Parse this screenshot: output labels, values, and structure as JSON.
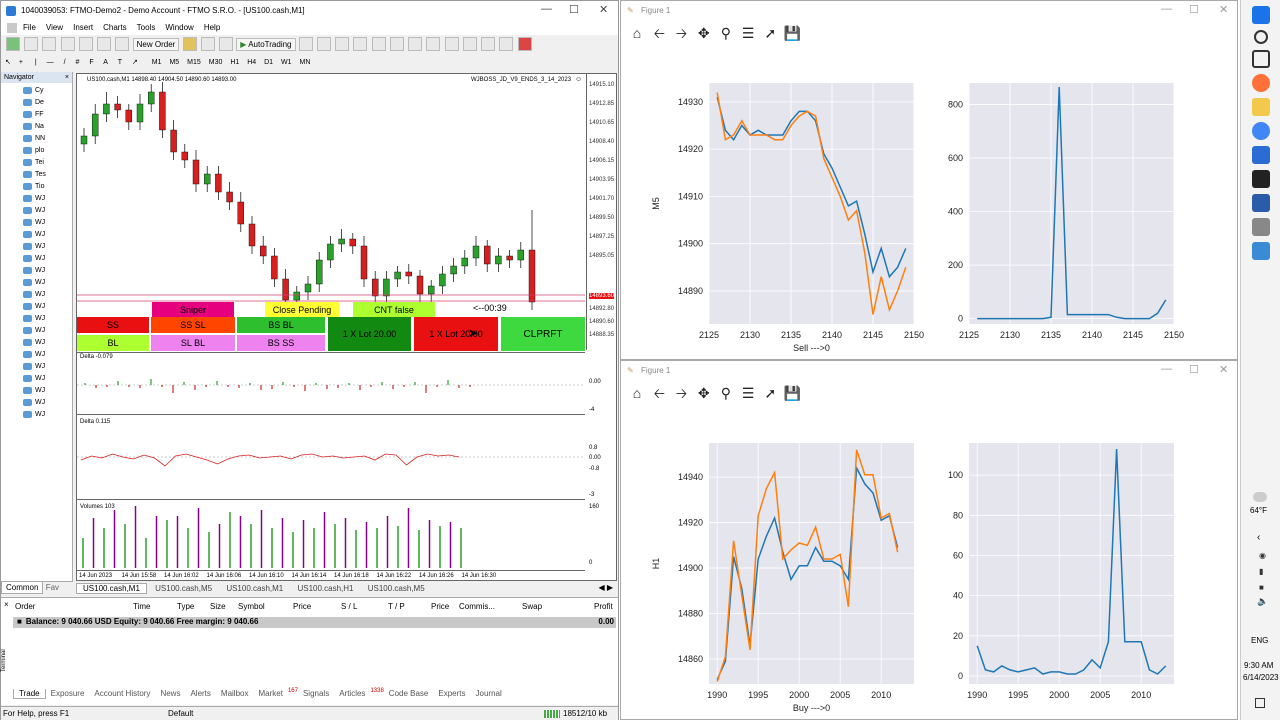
{
  "mt": {
    "title": "1040039053: FTMO-Demo2 - Demo Account - FTMO S.R.O. - [US100.cash,M1]",
    "menu": [
      "File",
      "View",
      "Insert",
      "Charts",
      "Tools",
      "Window",
      "Help"
    ],
    "new_order": "New Order",
    "autotrading": "AutoTrading",
    "timeframes": [
      "M1",
      "M5",
      "M15",
      "M30",
      "H1",
      "H4",
      "D1",
      "W1",
      "MN"
    ],
    "navigator_title": "Navigator",
    "nav_items": [
      "Cy",
      "De",
      "FF",
      "Na",
      "NN",
      "plo",
      "Tei",
      "Tes",
      "Tio",
      "WJ",
      "WJ",
      "WJ",
      "WJ",
      "WJ",
      "WJ",
      "WJ",
      "WJ",
      "WJ",
      "WJ",
      "WJ",
      "WJ",
      "WJ",
      "WJ",
      "WJ",
      "WJ",
      "WJ",
      "WJ",
      "WJ"
    ],
    "nav_tabs": [
      "Common",
      "Fav"
    ],
    "chart_header": "US100.cash,M1  14898.40 14904.50 14890.60 14893.00",
    "ea_label": "WJBOSS_JD_V9_ENDS_3_14_2023",
    "price_labels": [
      "14915.10",
      "14912.85",
      "14910.65",
      "14908.40",
      "14906.15",
      "14903.95",
      "14901.70",
      "14899.50",
      "14897.25",
      "14895.05",
      "14893.60",
      "14892.80",
      "14890.60",
      "14888.35"
    ],
    "current_price": "14893.60",
    "timer": "<--00:39",
    "btn_sniper": "Sniper",
    "btn_close_pending": "Close Pending",
    "btn_cnt": "CNT  false",
    "btn_ss": "SS",
    "btn_ss_sl": "SS SL",
    "btn_bs_bl": "BS BL",
    "btn_lot20": "1 X Lot 20.00",
    "btn_lot": "1 X Lot 20.00",
    "btn_clprft": "CLPRFT",
    "btn_bl": "BL",
    "btn_sl_bl": "SL BL",
    "btn_bs_ss": "BS SS",
    "delta1_label": "Delta -0.079",
    "delta1_scale": [
      "0.00",
      "-4"
    ],
    "delta2_label": "Delta 0.115",
    "delta2_scale": [
      "0.8",
      "0.00",
      "-0.8",
      "-3"
    ],
    "vol_label": "Volumes 103",
    "vol_scale": [
      "160",
      "0"
    ],
    "time_labels": [
      "14 Jun 2023",
      "14 Jun 15:58",
      "14 Jun 16:02",
      "14 Jun 16:06",
      "14 Jun 16:10",
      "14 Jun 16:14",
      "14 Jun 16:18",
      "14 Jun 16:22",
      "14 Jun 16:26",
      "14 Jun 16:30"
    ],
    "chart_tabs": [
      "US100.cash,M1",
      "US100.cash,M5",
      "US100.cash,M1",
      "US100.cash,H1",
      "US100.cash,M5"
    ],
    "term_cols": [
      "Order",
      "Time",
      "Type",
      "Size",
      "Symbol",
      "Price",
      "S / L",
      "T / P",
      "Price",
      "Commis...",
      "Swap",
      "Profit"
    ],
    "balance": "Balance: 9 040.66 USD  Equity: 9 040.66  Free margin: 9 040.66",
    "profit": "0.00",
    "term_tabs": [
      "Trade",
      "Exposure",
      "Account History",
      "News",
      "Alerts",
      "Mailbox",
      "Market",
      "Signals",
      "Articles",
      "Code Base",
      "Experts",
      "Journal"
    ],
    "market_badge": "167",
    "articles_badge": "1338",
    "terminal_side": "Terminal",
    "status_left": "For Help, press F1",
    "status_mid": "Default",
    "status_right": "18512/10 kb"
  },
  "fig1": {
    "title": "Figure 1",
    "left": {
      "ylabel": "M5",
      "xlabel": "Sell --->0",
      "xticks": [
        "2125",
        "2130",
        "2135",
        "2140",
        "2145",
        "2150"
      ],
      "yticks": [
        "14930",
        "14920",
        "14910",
        "14900",
        "14890"
      ]
    },
    "right": {
      "xticks": [
        "2125",
        "2130",
        "2135",
        "2140",
        "2145",
        "2150"
      ],
      "yticks": [
        "800",
        "600",
        "400",
        "200",
        "0"
      ]
    }
  },
  "fig2": {
    "title": "Figure 1",
    "left": {
      "ylabel": "H1",
      "xlabel": "Buy --->0",
      "xticks": [
        "1990",
        "1995",
        "2000",
        "2005",
        "2010"
      ],
      "yticks": [
        "14940",
        "14920",
        "14900",
        "14880",
        "14860"
      ]
    },
    "right": {
      "xticks": [
        "1990",
        "1995",
        "2000",
        "2005",
        "2010"
      ],
      "yticks": [
        "100",
        "80",
        "60",
        "40",
        "20",
        "0"
      ]
    }
  },
  "taskbar": {
    "weather": "64°F",
    "lang": "ENG",
    "time": "9:30 AM",
    "date": "6/14/2023"
  },
  "colors": {
    "blue": "#1f77b4",
    "orange": "#ff7f0e",
    "plotbg": "#e5e5ee"
  },
  "chart_data": [
    {
      "type": "line",
      "ylabel": "M5",
      "xlabel": "Sell --->0",
      "xlim": [
        2125,
        2150
      ],
      "ylim": [
        14883,
        14934
      ],
      "x": [
        2126,
        2127,
        2128,
        2129,
        2130,
        2131,
        2132,
        2133,
        2134,
        2135,
        2136,
        2137,
        2138,
        2139,
        2140,
        2141,
        2142,
        2143,
        2144,
        2145,
        2146,
        2147,
        2148,
        2149
      ],
      "series": [
        {
          "values": [
            14931,
            14924,
            14922,
            14925,
            14923,
            14924,
            14923,
            14923,
            14923,
            14926,
            14928,
            14928,
            14926,
            14919,
            14916,
            14912,
            14908,
            14909,
            14902,
            14894,
            14899,
            14893,
            14895,
            14899
          ]
        },
        {
          "values": [
            14932,
            14922,
            14923,
            14926,
            14923,
            14923,
            14923,
            14922,
            14922,
            14925,
            14927,
            14928,
            14927,
            14918,
            14914,
            14910,
            14905,
            14907,
            14898,
            14885,
            14893,
            14886,
            14890,
            14895
          ]
        }
      ]
    },
    {
      "type": "line",
      "xlim": [
        2125,
        2150
      ],
      "ylim": [
        -20,
        880
      ],
      "x": [
        2126,
        2127,
        2128,
        2129,
        2130,
        2131,
        2132,
        2133,
        2134,
        2135,
        2136,
        2137,
        2138,
        2139,
        2140,
        2141,
        2142,
        2143,
        2144,
        2145,
        2146,
        2147,
        2148,
        2149
      ],
      "series": [
        {
          "values": [
            0,
            0,
            0,
            0,
            0,
            0,
            0,
            0,
            0,
            5,
            865,
            15,
            15,
            15,
            15,
            15,
            15,
            5,
            0,
            0,
            0,
            0,
            20,
            70
          ]
        }
      ]
    },
    {
      "type": "line",
      "ylabel": "H1",
      "xlabel": "Buy --->0",
      "xlim": [
        1989,
        2014
      ],
      "ylim": [
        14849,
        14955
      ],
      "x": [
        1990,
        1991,
        1992,
        1993,
        1994,
        1995,
        1996,
        1997,
        1998,
        1999,
        2000,
        2001,
        2002,
        2003,
        2004,
        2005,
        2006,
        2007,
        2008,
        2009,
        2010,
        2011,
        2012,
        2013
      ],
      "series": [
        {
          "values": [
            14851,
            14859,
            14905,
            14891,
            14866,
            14904,
            14914,
            14922,
            14907,
            14895,
            14901,
            14901,
            14909,
            14903,
            14903,
            14901,
            14895,
            14944,
            14937,
            14933,
            14921,
            14923,
            14909
          ]
        },
        {
          "values": [
            14850,
            14861,
            14912,
            14888,
            14864,
            14923,
            14935,
            14942,
            14904,
            14908,
            14911,
            14910,
            14918,
            14904,
            14904,
            14906,
            14883,
            14952,
            14941,
            14941,
            14922,
            14924,
            14907
          ]
        }
      ]
    },
    {
      "type": "line",
      "xlim": [
        1989,
        2014
      ],
      "ylim": [
        -4,
        116
      ],
      "x": [
        1990,
        1991,
        1992,
        1993,
        1994,
        1995,
        1996,
        1997,
        1998,
        1999,
        2000,
        2001,
        2002,
        2003,
        2004,
        2005,
        2006,
        2007,
        2008,
        2009,
        2010,
        2011,
        2012,
        2013
      ],
      "series": [
        {
          "values": [
            15,
            3,
            2,
            5,
            3,
            2,
            3,
            4,
            1,
            2,
            2,
            1,
            1,
            3,
            8,
            4,
            17,
            113,
            17,
            17,
            17,
            3,
            1,
            5
          ]
        }
      ]
    }
  ]
}
